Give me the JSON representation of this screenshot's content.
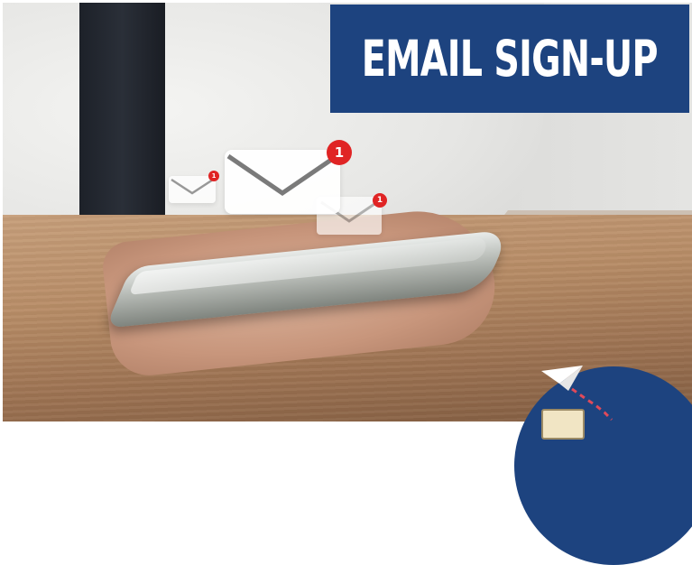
{
  "banner": {
    "title": "EMAIL SIGN-UP"
  },
  "colors": {
    "banner_bg": "#1d437f",
    "badge": "#e02424",
    "envelope": "#ffffff"
  },
  "notifications": {
    "main_count": "1",
    "left_count": "1",
    "right_count": "1"
  },
  "icons": [
    "envelope-icon",
    "notification-badge",
    "paper-plane-icon"
  ]
}
